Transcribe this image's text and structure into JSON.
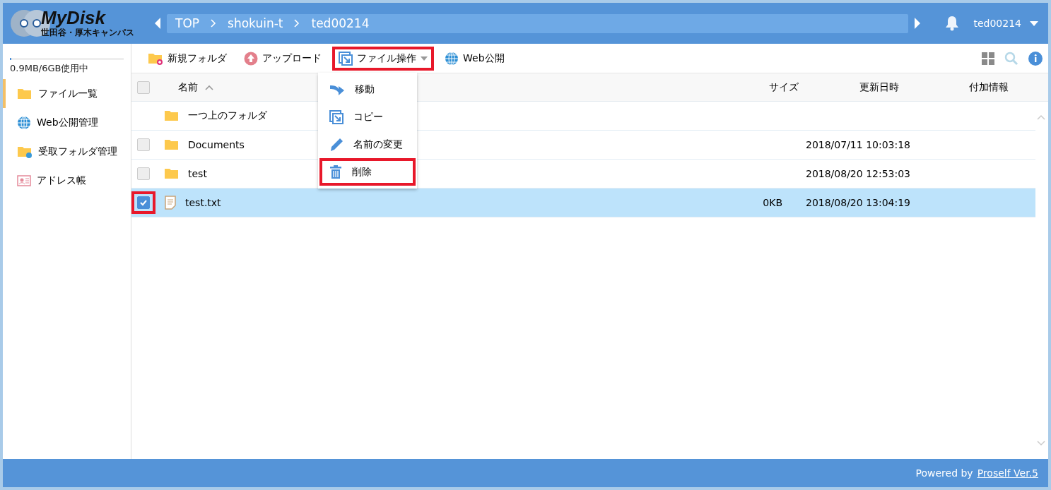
{
  "logo": {
    "title": "MyDisk",
    "subtitle": "世田谷・厚木キャンパス"
  },
  "breadcrumb": [
    "TOP",
    "shokuin-t",
    "ted00214"
  ],
  "user": {
    "name": "ted00214"
  },
  "storage": {
    "level": 0.01,
    "reading": "0.9MB/6GB使用中"
  },
  "sidebar": {
    "items": [
      {
        "label": "ファイル一覧",
        "kind": "folder",
        "selected": true
      },
      {
        "label": "Web公開管理",
        "kind": "globe",
        "selected": false
      },
      {
        "label": "受取フォルダ管理",
        "kind": "shared-folder",
        "selected": false
      },
      {
        "label": "アドレス帳",
        "kind": "card",
        "selected": false
      }
    ]
  },
  "toolbar": [
    {
      "label": "新規フォルダ",
      "kind": "new-folder",
      "highlighted": false
    },
    {
      "label": "アップロード",
      "kind": "upload",
      "highlighted": false
    },
    {
      "label": "ファイル操作",
      "kind": "file-ops",
      "highlighted": true,
      "expanded": true
    },
    {
      "label": "Web公開",
      "kind": "globe",
      "highlighted": false
    }
  ],
  "menu": [
    {
      "label": "移動",
      "kind": "move",
      "highlighted": false
    },
    {
      "label": "コピー",
      "kind": "copy",
      "highlighted": false
    },
    {
      "label": "名前の変更",
      "kind": "rename",
      "highlighted": false
    },
    {
      "label": "削除",
      "kind": "delete",
      "highlighted": true
    }
  ],
  "table": {
    "all_checked": false,
    "columns": [
      "名前",
      "サイズ",
      "更新日時",
      "付加情報"
    ],
    "rows": [
      {
        "kind": "parent",
        "name": "一つ上のフォルダ"
      },
      {
        "kind": "folder",
        "name": "Documents",
        "modified": "2018/07/11 10:03:18",
        "checked": false,
        "highlighted": false
      },
      {
        "kind": "folder",
        "name": "test",
        "modified": "2018/08/20 12:53:03",
        "checked": false,
        "highlighted": false
      },
      {
        "kind": "file",
        "name": "test.txt",
        "size": "0KB",
        "modified": "2018/08/20 13:04:19",
        "checked": true,
        "highlighted": true
      }
    ]
  },
  "footer": {
    "text": "Powered by",
    "link": "Proself Ver.5"
  }
}
